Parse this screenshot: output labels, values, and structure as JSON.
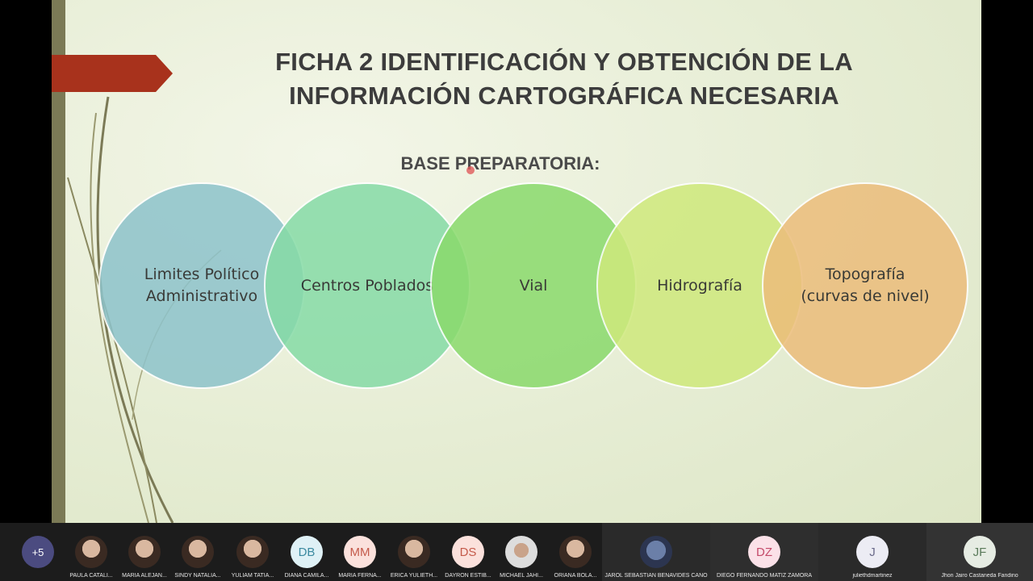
{
  "slide": {
    "title": "FICHA 2 IDENTIFICACIÓN Y OBTENCIÓN DE LA INFORMACIÓN CARTOGRÁFICA NECESARIA",
    "subtitle": "BASE PREPARATORIA:",
    "circles": [
      {
        "label": "Limites Político Administrativo",
        "color": "#8dc3cb"
      },
      {
        "label": "Centros Poblados",
        "color": "#86dba6"
      },
      {
        "label": "Vial",
        "color": "#8ada6c"
      },
      {
        "label": "Hidrografía",
        "color": "#cfe97c"
      },
      {
        "label": "Topografía (curvas de nivel)",
        "color": "#ecbd7b"
      }
    ]
  },
  "participants": {
    "more_count": "+5",
    "strip": [
      {
        "initials": "",
        "name": "PAULA CATALI..."
      },
      {
        "initials": "",
        "name": "MARIA ALEJAN..."
      },
      {
        "initials": "",
        "name": "SINDY NATALIA..."
      },
      {
        "initials": "",
        "name": "YULIAM TATIA..."
      },
      {
        "initials": "DB",
        "name": "DIANA CAMILA..."
      },
      {
        "initials": "MM",
        "name": "MARIA FERNA..."
      },
      {
        "initials": "",
        "name": "ERICA YULIETH..."
      },
      {
        "initials": "DS",
        "name": "DAYRON ESTIB..."
      },
      {
        "initials": "",
        "name": "MICHAEL JAHI..."
      },
      {
        "initials": "",
        "name": "ORIANA BOLA..."
      }
    ],
    "tiles": [
      {
        "initials": "",
        "name": "JAROL SEBASTIAN BENAVIDES CANO"
      },
      {
        "initials": "DZ",
        "name": "DIEGO FERNANDO MATIZ ZAMORA"
      },
      {
        "initials": "J",
        "name": "juliethdmartinez"
      },
      {
        "initials": "JF",
        "name": "Jhon Jairo Castaneda Fandino"
      }
    ]
  }
}
